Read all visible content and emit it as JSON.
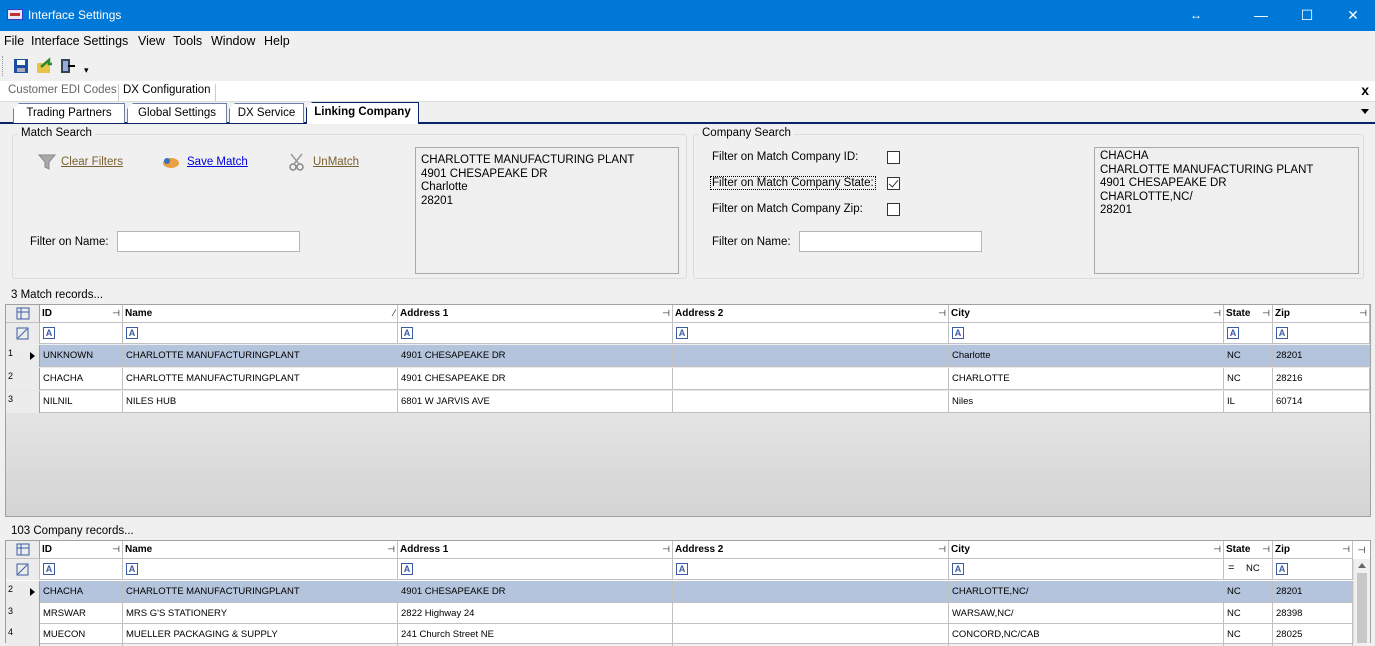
{
  "window": {
    "title": "Interface Settings",
    "resize_glyph": "↔",
    "minimize": "—",
    "maximize": "☐",
    "close": "✕"
  },
  "menu": [
    "File",
    "Interface Settings",
    "View",
    "Tools",
    "Window",
    "Help"
  ],
  "toolbar_icons": [
    "save-icon",
    "export-icon",
    "exit-icon",
    "overflow-icon"
  ],
  "doc_tabs": {
    "items": [
      "Customer EDI Codes",
      "DX Configuration"
    ],
    "active": "DX Configuration",
    "close": "x"
  },
  "tabs": {
    "items": [
      "Trading Partners",
      "Global Settings",
      "DX Service",
      "Linking Company"
    ],
    "active": "Linking Company"
  },
  "match_search": {
    "title": "Match Search",
    "clear_filters": "Clear Filters",
    "save_match": "Save Match",
    "unmatch": "UnMatch",
    "filter_name_label": "Filter on Name:",
    "filter_name_value": "",
    "address": [
      "CHARLOTTE MANUFACTURING PLANT",
      "4901 CHESAPEAKE DR",
      "Charlotte",
      "28201"
    ]
  },
  "company_search": {
    "title": "Company Search",
    "filter_id_label": "Filter on Match Company ID:",
    "filter_id_checked": false,
    "filter_state_label": "Filter on Match Company State:",
    "filter_state_checked": true,
    "filter_zip_label": "Filter on Match Company Zip:",
    "filter_zip_checked": false,
    "filter_name_label": "Filter on Name:",
    "filter_name_value": "",
    "address": [
      "CHACHA",
      "CHARLOTTE MANUFACTURING PLANT",
      "4901 CHESAPEAKE DR",
      "CHARLOTTE,NC/",
      "28201"
    ]
  },
  "match_grid": {
    "label": "3 Match records...",
    "columns": [
      "ID",
      "Name",
      "Address 1",
      "Address 2",
      "City",
      "State",
      "Zip"
    ],
    "rows": [
      {
        "n": "1",
        "cells": [
          "UNKNOWN",
          "CHARLOTTE MANUFACTURINGPLANT",
          "4901 CHESAPEAKE DR",
          "",
          "Charlotte",
          "NC",
          "28201"
        ]
      },
      {
        "n": "2",
        "cells": [
          "CHACHA",
          "CHARLOTTE MANUFACTURINGPLANT",
          "4901 CHESAPEAKE DR",
          "",
          "CHARLOTTE",
          "NC",
          "28216"
        ]
      },
      {
        "n": "3",
        "cells": [
          "NILNIL",
          "NILES HUB",
          "6801 W JARVIS AVE",
          "",
          "Niles",
          "IL",
          "60714"
        ]
      }
    ],
    "selected_row": 1
  },
  "company_grid": {
    "label": "103 Company records...",
    "columns": [
      "ID",
      "Name",
      "Address 1",
      "Address 2",
      "City",
      "State",
      "Zip"
    ],
    "state_filter_op": "=",
    "state_filter_value": "NC",
    "rows": [
      {
        "n": "2",
        "cells": [
          "CHACHA",
          "CHARLOTTE MANUFACTURINGPLANT",
          "4901 CHESAPEAKE DR",
          "",
          "CHARLOTTE,NC/",
          "NC",
          "28201"
        ]
      },
      {
        "n": "3",
        "cells": [
          "MRSWAR",
          "MRS G'S STATIONERY",
          "2822 Highway 24",
          "",
          "WARSAW,NC/",
          "NC",
          "28398"
        ]
      },
      {
        "n": "4",
        "cells": [
          "MUECON",
          "MUELLER PACKAGING & SUPPLY",
          "241 Church Street NE",
          "",
          "CONCORD,NC/CAB",
          "NC",
          "28025"
        ]
      }
    ],
    "selected_row": 2
  }
}
